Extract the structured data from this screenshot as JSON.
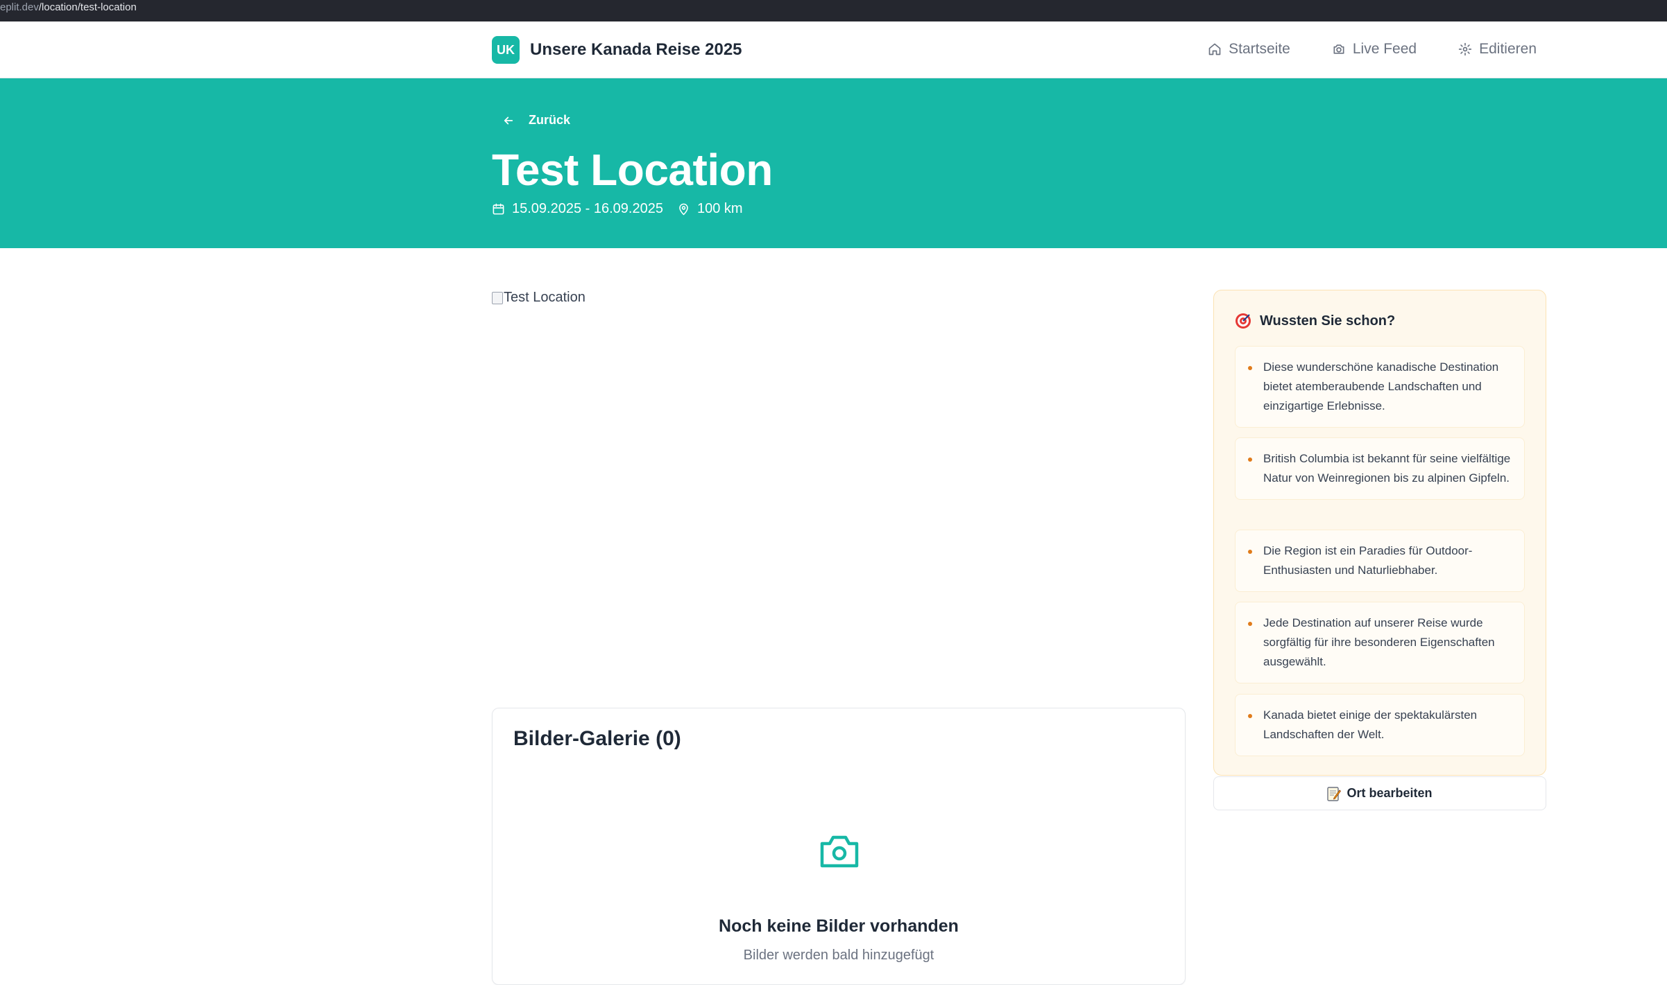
{
  "browser": {
    "url_prefix": "eplit.dev",
    "url_path": "/location/test-location"
  },
  "nav": {
    "brand_badge": "UK",
    "brand_title": "Unsere Kanada Reise 2025",
    "links": [
      {
        "label": "Startseite",
        "icon": "home-icon"
      },
      {
        "label": "Live Feed",
        "icon": "camera-icon"
      },
      {
        "label": "Editieren",
        "icon": "gear-icon"
      }
    ]
  },
  "hero": {
    "back_label": "Zurück",
    "title": "Test Location",
    "dates": "15.09.2025 - 16.09.2025",
    "distance": "100 km"
  },
  "main": {
    "image_alt": "Test Location",
    "gallery": {
      "title": "Bilder-Galerie (0)",
      "empty_title": "Noch keine Bilder vorhanden",
      "empty_sub": "Bilder werden bald hinzugefügt"
    }
  },
  "sidebar": {
    "facts_title": "Wussten Sie schon?",
    "facts": [
      "Diese wunderschöne kanadische Destination bietet atemberaubende Landschaften und einzigartige Erlebnisse.",
      "British Columbia ist bekannt für seine vielfältige Natur von Weinregionen bis zu alpinen Gipfeln.",
      "Die Region ist ein Paradies für Outdoor-Enthusiasten und Naturliebhaber.",
      "Jede Destination auf unserer Reise wurde sorgfältig für ihre besonderen Eigenschaften ausgewählt.",
      "Kanada bietet einige der spektakulärsten Landschaften der Welt."
    ],
    "edit_label": "Ort bearbeiten"
  },
  "colors": {
    "accent": "#17b8a6",
    "facts_bg": "#fef8ec",
    "bullet": "#e07b1a"
  }
}
